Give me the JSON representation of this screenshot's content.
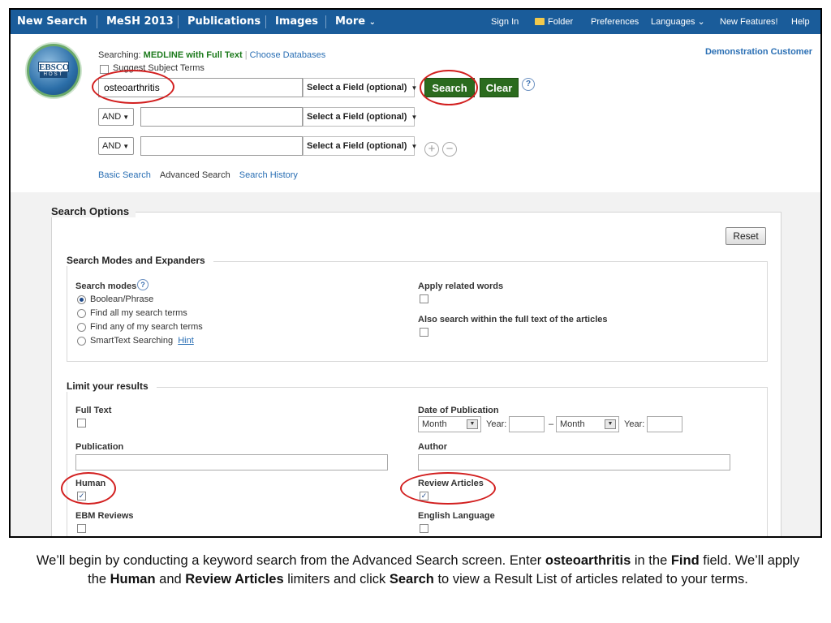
{
  "nav": {
    "left": [
      "New Search",
      "MeSH 2013",
      "Publications",
      "Images",
      "More"
    ],
    "more_caret": "⌄",
    "right": [
      "Sign In",
      "Folder",
      "Preferences",
      "Languages",
      "New Features!",
      "Help"
    ],
    "nav_bg": "#1a5c9a"
  },
  "header": {
    "logo_top": "EBSCO",
    "logo_bottom": "HOST",
    "searching_label": "Searching:",
    "database": "MEDLINE with Full Text",
    "choose_db": "Choose Databases",
    "suggest_label": "Suggest Subject Terms",
    "customer": "Demonstration Customer",
    "rows": [
      {
        "value": "osteoarthritis",
        "field": "Select a Field (optional)"
      },
      {
        "op": "AND",
        "value": "",
        "field": "Select a Field (optional)"
      },
      {
        "op": "AND",
        "value": "",
        "field": "Select a Field (optional)"
      }
    ],
    "search_btn": "Search",
    "clear_btn": "Clear",
    "help": "?",
    "plus": "+",
    "minus": "−",
    "links": [
      "Basic Search",
      "Advanced Search",
      "Search History"
    ]
  },
  "options": {
    "title": "Search Options",
    "reset": "Reset",
    "modes_section": "Search Modes and Expanders",
    "modes_label": "Search modes",
    "modes": [
      "Boolean/Phrase",
      "Find all my search terms",
      "Find any of my search terms",
      "SmartText Searching"
    ],
    "hint": "Hint",
    "selected_mode": 0,
    "related_words": "Apply related words",
    "full_text_search": "Also search within the full text of the articles",
    "limit_section": "Limit your results",
    "full_text": "Full Text",
    "date_pub": "Date of Publication",
    "month": "Month",
    "year": "Year:",
    "dash": "–",
    "publication": "Publication",
    "author": "Author",
    "human": "Human",
    "review": "Review Articles",
    "ebm": "EBM Reviews",
    "english": "English Language",
    "checked_mark": "✓"
  },
  "caption": {
    "p1": "We’ll begin by conducting a keyword search from the Advanced Search screen.  Enter ",
    "b1": "osteoarthritis",
    "p2": " in the ",
    "b2": "Find",
    "p3": " field. We’ll apply the ",
    "b3": "Human",
    "p4": " and ",
    "b4": "Review Articles",
    "p5": " limiters and click ",
    "b5": "Search",
    "p6": " to view a Result List of articles related to your terms."
  },
  "colors": {
    "annotation": "#d21f1f",
    "button_green": "#2b6b1e",
    "link": "#2a6fb4"
  }
}
